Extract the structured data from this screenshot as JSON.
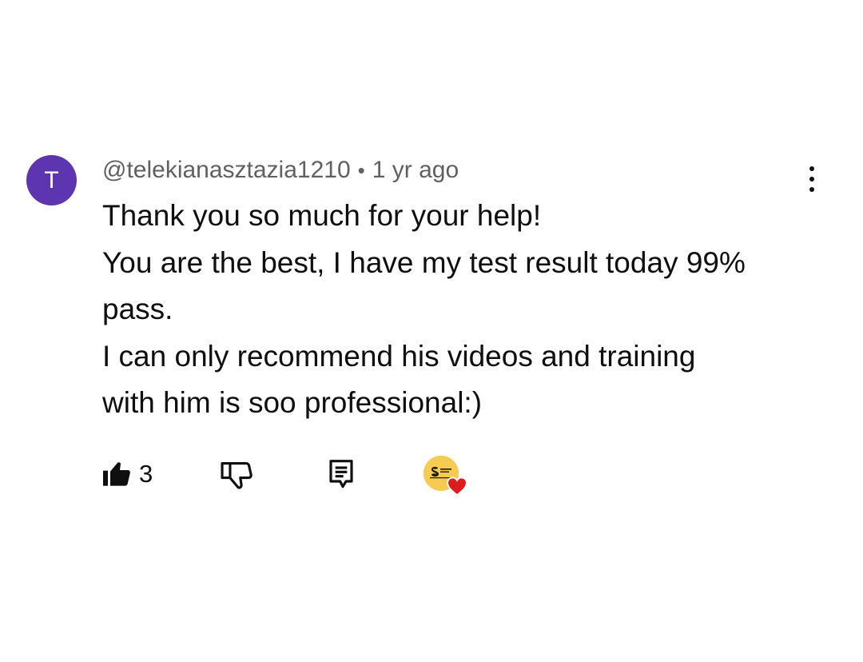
{
  "comment": {
    "avatar_letter": "T",
    "avatar_color": "#5e35b1",
    "author": "@telekianasztazia1210",
    "separator": "•",
    "timestamp": "1 yr ago",
    "body_lines": [
      "Thank you so much for your help!",
      "You are the best, I have my test result today 99%",
      "pass.",
      "I can only recommend his videos and training",
      "with him is soo professional:)"
    ],
    "like_count": "3",
    "heart_color": "#e01b1b",
    "creator_avatar_color": "#f5cb52"
  },
  "icons": {
    "more": "three-dot-vertical-icon",
    "like": "thumbs-up-filled-icon",
    "dislike": "thumbs-down-outline-icon",
    "reply": "comment-reply-icon",
    "creator_heart": "creator-heart-badge-icon"
  }
}
